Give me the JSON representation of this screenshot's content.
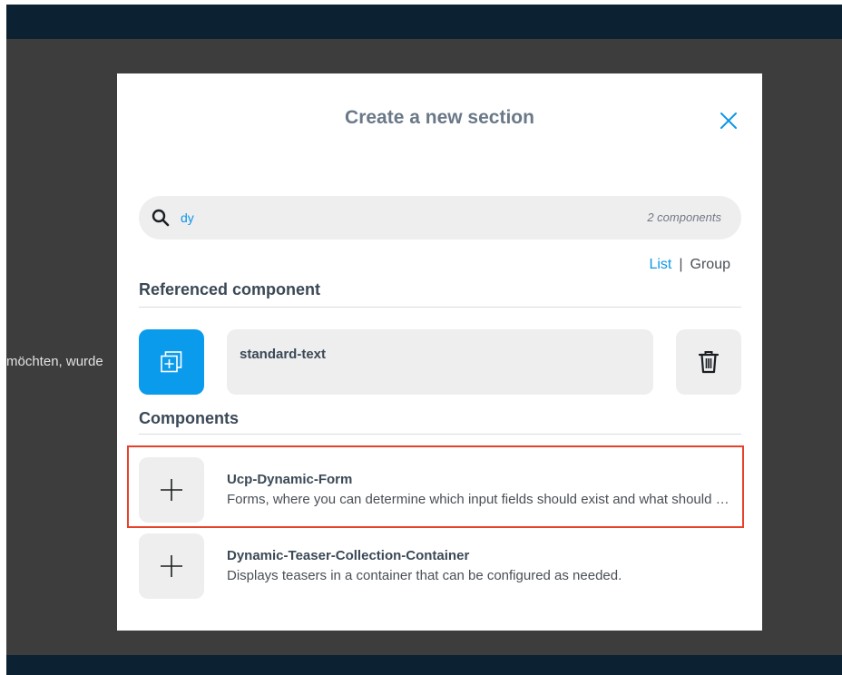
{
  "background": {
    "partial_text": "möchten, wurde"
  },
  "modal": {
    "title": "Create a new section",
    "close_icon": "close-icon",
    "search": {
      "value": "dy",
      "count": "2 components",
      "icon": "search-icon"
    },
    "view_toggle": {
      "active": "List",
      "separator": "|",
      "inactive": "Group"
    },
    "referenced_section": {
      "title": "Referenced component",
      "component_name": "standard-text",
      "tile_icon": "add-reference-icon",
      "delete_icon": "trash-icon"
    },
    "components_section": {
      "title": "Components",
      "items": [
        {
          "name": "Ucp-Dynamic-Form",
          "description": "Forms, where you can determine which input fields should exist and what should happen with the entered data.",
          "highlighted": true
        },
        {
          "name": "Dynamic-Teaser-Collection-Container",
          "description": "Displays teasers in a container that can be configured as needed.",
          "highlighted": false
        }
      ]
    }
  },
  "colors": {
    "accent": "#0a9bec",
    "highlight": "#e8412a",
    "header_bar": "#0c2131",
    "overlay": "#3d3d3d"
  }
}
